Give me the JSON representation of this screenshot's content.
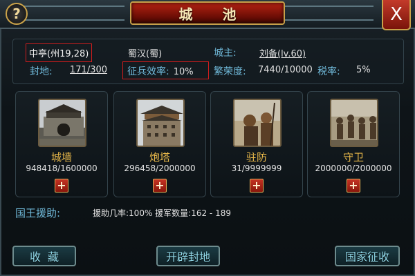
{
  "window": {
    "title": "城  池",
    "help_symbol": "?",
    "close_symbol": "X"
  },
  "city_info": {
    "location": "中亭(州19,28)",
    "faction": "蜀汉(蜀)",
    "lord_label": "城主:",
    "lord_value": "刘备(lv.60)",
    "fief_label": "封地:",
    "fief_value": "171/300",
    "recruit_efficiency_label": "征兵效率:",
    "recruit_efficiency_value": "10%",
    "prosperity_label": "繁荣度:",
    "prosperity_value": "7440/10000",
    "tax_label": "税率:",
    "tax_value": "5%"
  },
  "facilities": [
    {
      "name": "城墙",
      "value": "948418/1600000",
      "plus": "+"
    },
    {
      "name": "炮塔",
      "value": "296458/2000000",
      "plus": "+"
    },
    {
      "name": "驻防",
      "value": "31/9999999",
      "plus": "+"
    },
    {
      "name": "守卫",
      "value": "2000000/2000000",
      "plus": "+"
    }
  ],
  "king_aid": {
    "label": "国王援助:",
    "text": "援助几率:100%   援军数量:162 - 189"
  },
  "buttons": {
    "collect": "收藏",
    "open_land": "开辟封地",
    "national_levy": "国家征收"
  },
  "colors": {
    "accent_label": "#6fb8d8",
    "facility_name": "#e9b94a",
    "title_red": "#b62313",
    "highlight_box": "#d21d1d"
  }
}
